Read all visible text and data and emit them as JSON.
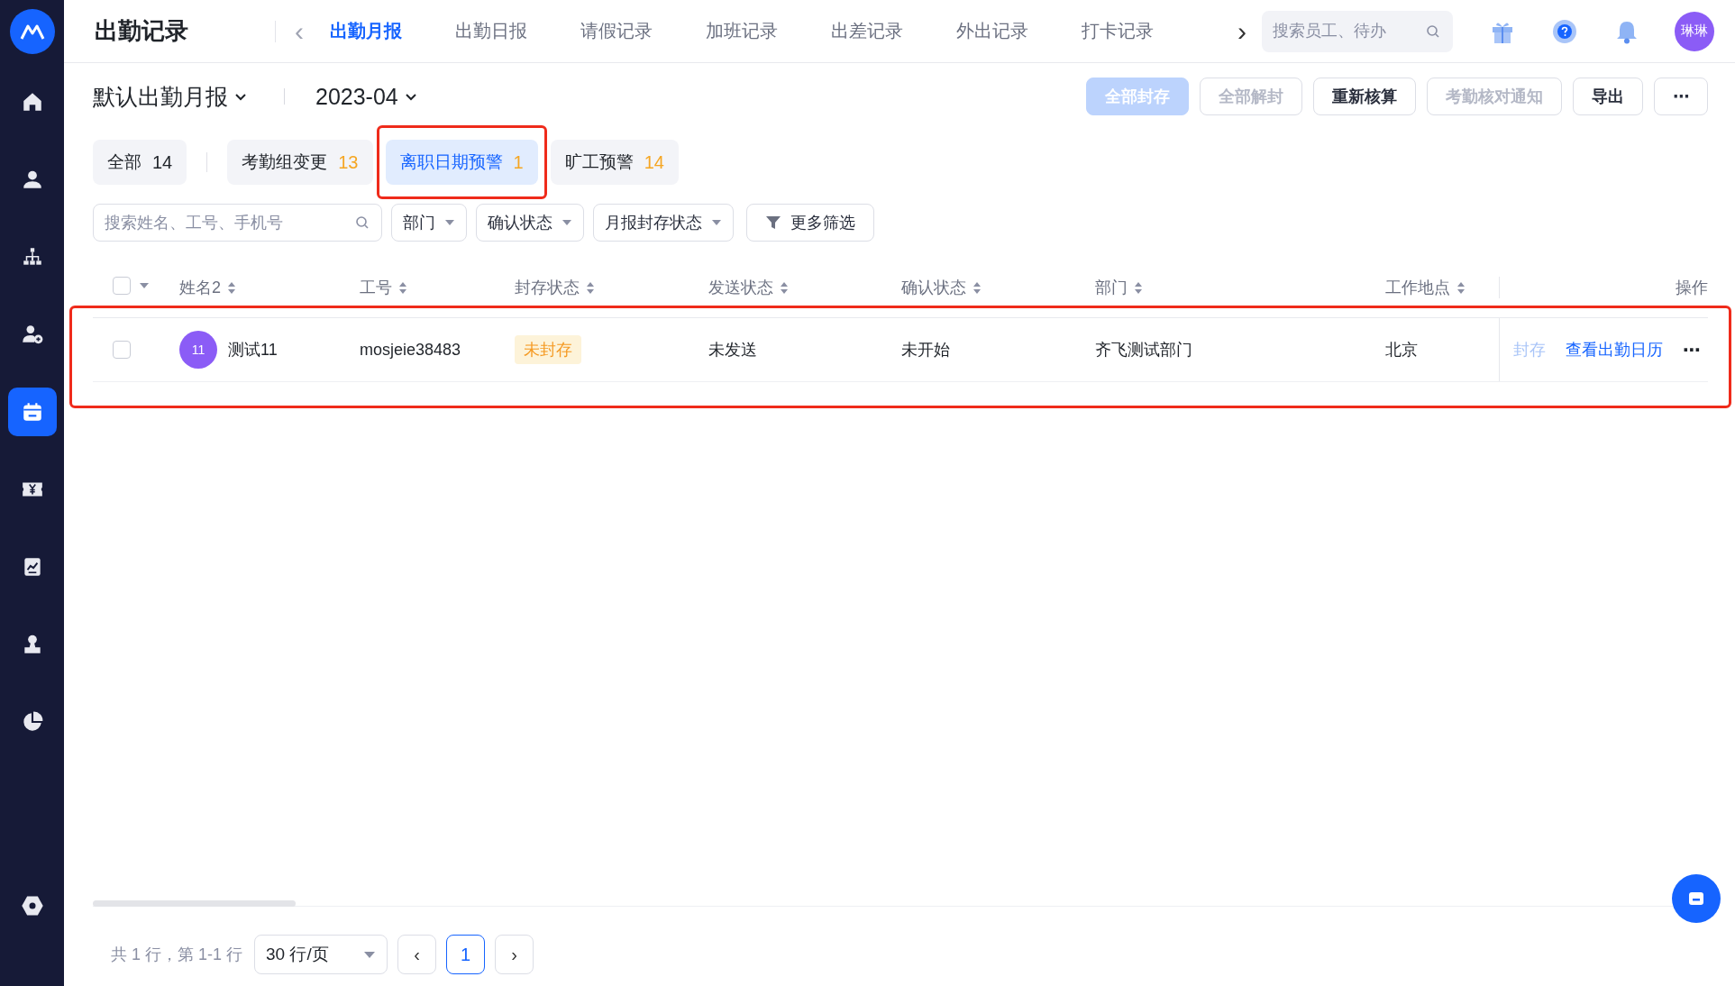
{
  "sidebar": {
    "items": [
      {
        "kind": "home",
        "selected": false
      },
      {
        "kind": "person",
        "selected": false
      },
      {
        "kind": "org",
        "selected": false
      },
      {
        "kind": "person-add",
        "selected": false
      },
      {
        "kind": "calendar",
        "selected": true
      },
      {
        "kind": "money",
        "selected": false
      },
      {
        "kind": "chart",
        "selected": false
      },
      {
        "kind": "stamp",
        "selected": false
      },
      {
        "kind": "pie",
        "selected": false
      }
    ],
    "bottom_item": {
      "kind": "settings"
    }
  },
  "header": {
    "title": "出勤记录",
    "scroll_left": "‹",
    "scroll_right": "›",
    "tabs": [
      {
        "label": "出勤月报",
        "selected": true
      },
      {
        "label": "出勤日报",
        "selected": false
      },
      {
        "label": "请假记录",
        "selected": false
      },
      {
        "label": "加班记录",
        "selected": false
      },
      {
        "label": "出差记录",
        "selected": false
      },
      {
        "label": "外出记录",
        "selected": false
      },
      {
        "label": "打卡记录",
        "selected": false
      }
    ],
    "search": {
      "placeholder": "搜索员工、待办"
    },
    "avatar": "琳琳"
  },
  "toolbar": {
    "report": "默认出勤月报",
    "month": "2023-04",
    "buttons": [
      {
        "label": "全部封存",
        "kind": "primary"
      },
      {
        "label": "全部解封",
        "kind": "disabled"
      },
      {
        "label": "重新核算",
        "kind": "default"
      },
      {
        "label": "考勤核对通知",
        "kind": "disabled"
      },
      {
        "label": "导出",
        "kind": "default"
      },
      {
        "label": "⋯",
        "kind": "default"
      }
    ]
  },
  "chips": [
    {
      "label": "全部",
      "count": "14",
      "selected": false,
      "highlighted": false
    },
    {
      "label": "考勤组变更",
      "count": "13",
      "selected": false,
      "highlighted": false
    },
    {
      "label": "离职日期预警",
      "count": "1",
      "selected": true,
      "highlighted": true
    },
    {
      "label": "旷工预警",
      "count": "14",
      "selected": false,
      "highlighted": false
    }
  ],
  "filters": {
    "search": {
      "placeholder": "搜索姓名、工号、手机号"
    },
    "dropdowns": [
      "部门",
      "确认状态",
      "月报封存状态"
    ],
    "more": "更多筛选"
  },
  "table": {
    "columns": [
      {
        "label": "姓名2",
        "sortable": true
      },
      {
        "label": "工号",
        "sortable": true
      },
      {
        "label": "封存状态",
        "sortable": true
      },
      {
        "label": "发送状态",
        "sortable": true
      },
      {
        "label": "确认状态",
        "sortable": true
      },
      {
        "label": "部门",
        "sortable": true
      },
      {
        "label": "工作地点",
        "sortable": true
      },
      {
        "label": "操作",
        "sortable": false
      }
    ],
    "header_checked": false,
    "rows": [
      {
        "checked": false,
        "highlighted": true,
        "avatar": "11",
        "name": "测试11",
        "id": "mosjeie38483",
        "seal_status": "未封存",
        "send_status": "未发送",
        "confirm_status": "未开始",
        "department": "齐飞测试部门",
        "location": "北京",
        "actions": [
          {
            "label": "封存",
            "disabled": true
          },
          {
            "label": "查看出勤日历",
            "disabled": false
          }
        ],
        "more": "⋯"
      }
    ]
  },
  "pagination": {
    "summary": "共 1 行，第 1-1 行",
    "page_size": "30 行/页",
    "prev": "‹",
    "pages": [
      {
        "label": "1",
        "selected": true
      }
    ],
    "next": "›"
  }
}
